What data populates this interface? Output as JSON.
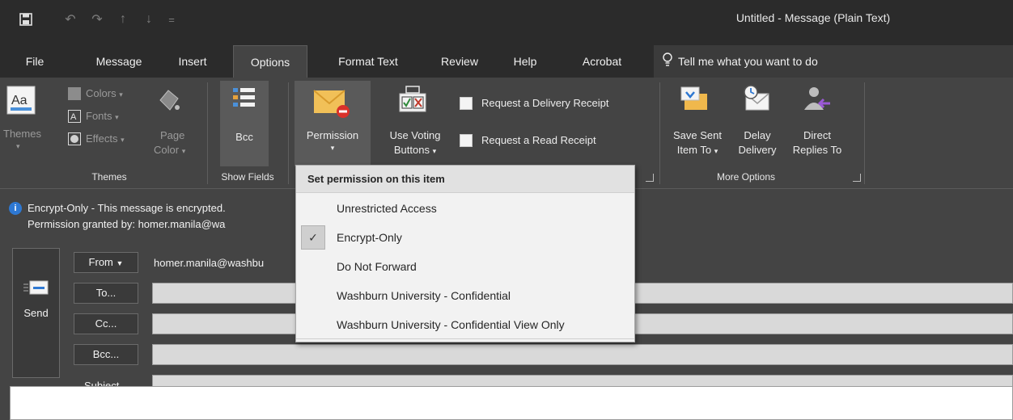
{
  "window": {
    "title": "Untitled  -  Message (Plain Text)"
  },
  "quick_access": {
    "icons": [
      "save-icon",
      "undo-icon",
      "redo-icon",
      "up-arrow-icon",
      "down-arrow-icon",
      "customize-icon"
    ]
  },
  "tabs": [
    {
      "label": "File"
    },
    {
      "label": "Message"
    },
    {
      "label": "Insert"
    },
    {
      "label": "Options",
      "active": true
    },
    {
      "label": "Format Text"
    },
    {
      "label": "Review"
    },
    {
      "label": "Help"
    },
    {
      "label": "Acrobat"
    }
  ],
  "tell_me": {
    "placeholder": "Tell me what you want to do"
  },
  "ribbon": {
    "themes": {
      "themes_label": "Themes",
      "colors_label": "Colors",
      "fonts_label": "Fonts",
      "effects_label": "Effects",
      "page_color_line1": "Page",
      "page_color_line2": "Color",
      "group_label": "Themes"
    },
    "show_fields": {
      "bcc_label": "Bcc",
      "group_label": "Show Fields"
    },
    "permission": {
      "label": "Permission"
    },
    "tracking": {
      "voting_line1": "Use Voting",
      "voting_line2": "Buttons",
      "delivery_receipt": "Request a Delivery Receipt",
      "read_receipt": "Request a Read Receipt"
    },
    "more_options": {
      "save_sent_line1": "Save Sent",
      "save_sent_line2": "Item To",
      "delay_line1": "Delay",
      "delay_line2": "Delivery",
      "direct_line1": "Direct",
      "direct_line2": "Replies To",
      "group_label": "More Options"
    }
  },
  "info_bar": {
    "line1": "Encrypt-Only - This message is encrypted.",
    "line2": "Permission granted by: homer.manila@wa"
  },
  "header": {
    "send_label": "Send",
    "from_label": "From",
    "from_value": "homer.manila@washbu",
    "to_label": "To...",
    "cc_label": "Cc...",
    "bcc_label": "Bcc...",
    "subject_label": "Subject"
  },
  "permission_menu": {
    "header": "Set permission on this item",
    "items": [
      {
        "label": "Unrestricted Access",
        "checked": false
      },
      {
        "label": "Encrypt-Only",
        "checked": true
      },
      {
        "label": "Do Not Forward",
        "checked": false
      },
      {
        "label": "Washburn University - Confidential",
        "checked": false
      },
      {
        "label": "Washburn University - Confidential View Only",
        "checked": false
      }
    ],
    "check_mark": "✓"
  }
}
